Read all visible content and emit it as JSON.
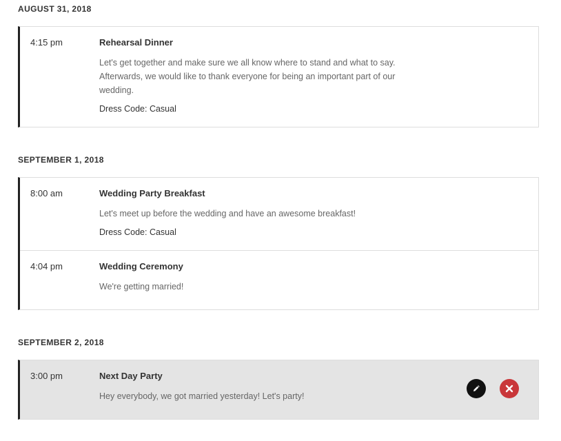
{
  "schedule": {
    "days": [
      {
        "date": "AUGUST 31, 2018",
        "events": [
          {
            "time": "4:15 pm",
            "title": "Rehearsal Dinner",
            "description": "Let's get together and make sure we all know where to stand and what to say. Afterwards, we would like to thank everyone for being an important part of our wedding.",
            "dress_code": "Dress Code: Casual"
          }
        ]
      },
      {
        "date": "SEPTEMBER 1, 2018",
        "events": [
          {
            "time": "8:00 am",
            "title": "Wedding Party Breakfast",
            "description": "Let's meet up before the wedding and have an awesome breakfast!",
            "dress_code": "Dress Code: Casual"
          },
          {
            "time": "4:04 pm",
            "title": "Wedding Ceremony",
            "description": "We're getting married!"
          }
        ]
      },
      {
        "date": "SEPTEMBER 2, 2018",
        "events": [
          {
            "time": "3:00 pm",
            "title": "Next Day Party",
            "description": "Hey everybody, we got married yesterday! Let's party!",
            "hovered": true,
            "actions": [
              {
                "name": "edit",
                "icon": "pencil-icon"
              },
              {
                "name": "delete",
                "icon": "close-icon"
              }
            ]
          }
        ]
      }
    ]
  },
  "colors": {
    "accent_border": "#222222",
    "hover_bg": "#e4e4e4",
    "edit_button": "#111111",
    "delete_button": "#c9373a"
  }
}
